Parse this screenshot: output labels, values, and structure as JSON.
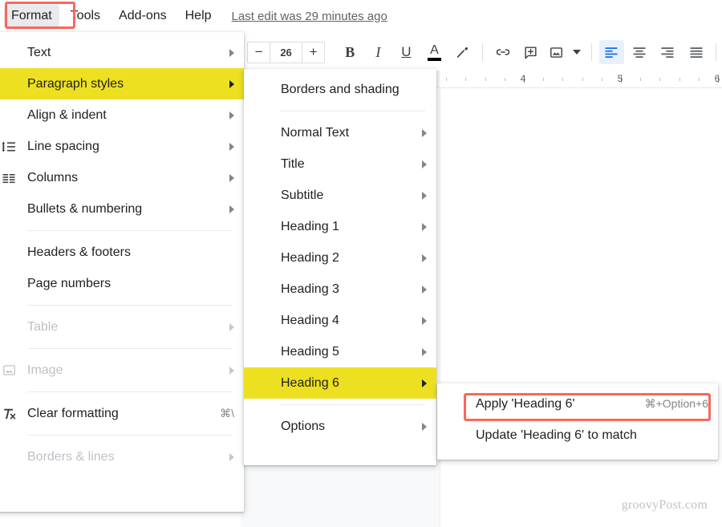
{
  "menubar": {
    "items": [
      {
        "label": "Format",
        "active": true
      },
      {
        "label": "Tools",
        "active": false
      },
      {
        "label": "Add-ons",
        "active": false
      },
      {
        "label": "Help",
        "active": false
      }
    ],
    "last_edit": "Last edit was 29 minutes ago"
  },
  "toolbar": {
    "font_size": "26",
    "decrease_label": "−",
    "increase_label": "+",
    "bold_label": "B",
    "italic_label": "I",
    "underline_label": "U",
    "text_color_label": "A",
    "icons": [
      "decrease-font-size-icon",
      "increase-font-size-icon",
      "bold-icon",
      "italic-icon",
      "underline-icon",
      "text-color-icon",
      "highlight-icon",
      "insert-link-icon",
      "add-comment-icon",
      "insert-image-icon",
      "align-left-icon",
      "align-center-icon",
      "align-right-icon",
      "justify-icon"
    ],
    "active_alignment": "align-left"
  },
  "ruler": {
    "numbers": [
      "4",
      "5",
      "6"
    ]
  },
  "document": {
    "watermark": "groovyPost.com"
  },
  "format_menu": {
    "items": [
      {
        "label": "Text",
        "icon": "",
        "arrow": true,
        "disabled": false,
        "accel": ""
      },
      {
        "label": "Paragraph styles",
        "icon": "",
        "arrow": true,
        "disabled": false,
        "accel": "",
        "highlighted": true
      },
      {
        "label": "Align & indent",
        "icon": "",
        "arrow": true,
        "disabled": false,
        "accel": ""
      },
      {
        "label": "Line spacing",
        "icon": "line-spacing-icon",
        "arrow": true,
        "disabled": false,
        "accel": ""
      },
      {
        "label": "Columns",
        "icon": "columns-icon",
        "arrow": true,
        "disabled": false,
        "accel": ""
      },
      {
        "label": "Bullets & numbering",
        "icon": "",
        "arrow": true,
        "disabled": false,
        "accel": ""
      },
      {
        "divider": true
      },
      {
        "label": "Headers & footers",
        "icon": "",
        "arrow": false,
        "disabled": false,
        "accel": ""
      },
      {
        "label": "Page numbers",
        "icon": "",
        "arrow": false,
        "disabled": false,
        "accel": ""
      },
      {
        "divider": true
      },
      {
        "label": "Table",
        "icon": "",
        "arrow": true,
        "disabled": true,
        "accel": ""
      },
      {
        "divider": true
      },
      {
        "label": "Image",
        "icon": "image-icon",
        "arrow": true,
        "disabled": true,
        "accel": ""
      },
      {
        "divider": true
      },
      {
        "label": "Clear formatting",
        "icon": "clear-formatting-icon",
        "arrow": false,
        "disabled": false,
        "accel": "⌘\\"
      },
      {
        "divider": true
      },
      {
        "label": "Borders & lines",
        "icon": "",
        "arrow": true,
        "disabled": true,
        "accel": ""
      }
    ]
  },
  "paragraph_styles_menu": {
    "items": [
      {
        "label": "Borders and shading",
        "arrow": false
      },
      {
        "divider": true
      },
      {
        "label": "Normal Text",
        "arrow": true
      },
      {
        "label": "Title",
        "arrow": true
      },
      {
        "label": "Subtitle",
        "arrow": true
      },
      {
        "label": "Heading 1",
        "arrow": true
      },
      {
        "label": "Heading 2",
        "arrow": true
      },
      {
        "label": "Heading 3",
        "arrow": true
      },
      {
        "label": "Heading 4",
        "arrow": true
      },
      {
        "label": "Heading 5",
        "arrow": true
      },
      {
        "label": "Heading 6",
        "arrow": true,
        "highlighted": true
      },
      {
        "divider": true
      },
      {
        "label": "Options",
        "arrow": true
      }
    ]
  },
  "heading6_menu": {
    "items": [
      {
        "label": "Apply 'Heading 6'",
        "accel": "⌘+Option+6",
        "annotated": true
      },
      {
        "label": "Update 'Heading 6' to match",
        "accel": ""
      }
    ]
  },
  "colors": {
    "highlight_yellow": "#ede021",
    "annotation_red": "#f9675b",
    "accent_blue": "#1a73e8",
    "menu_text": "#202124",
    "disabled_text": "#bdc1c6"
  }
}
